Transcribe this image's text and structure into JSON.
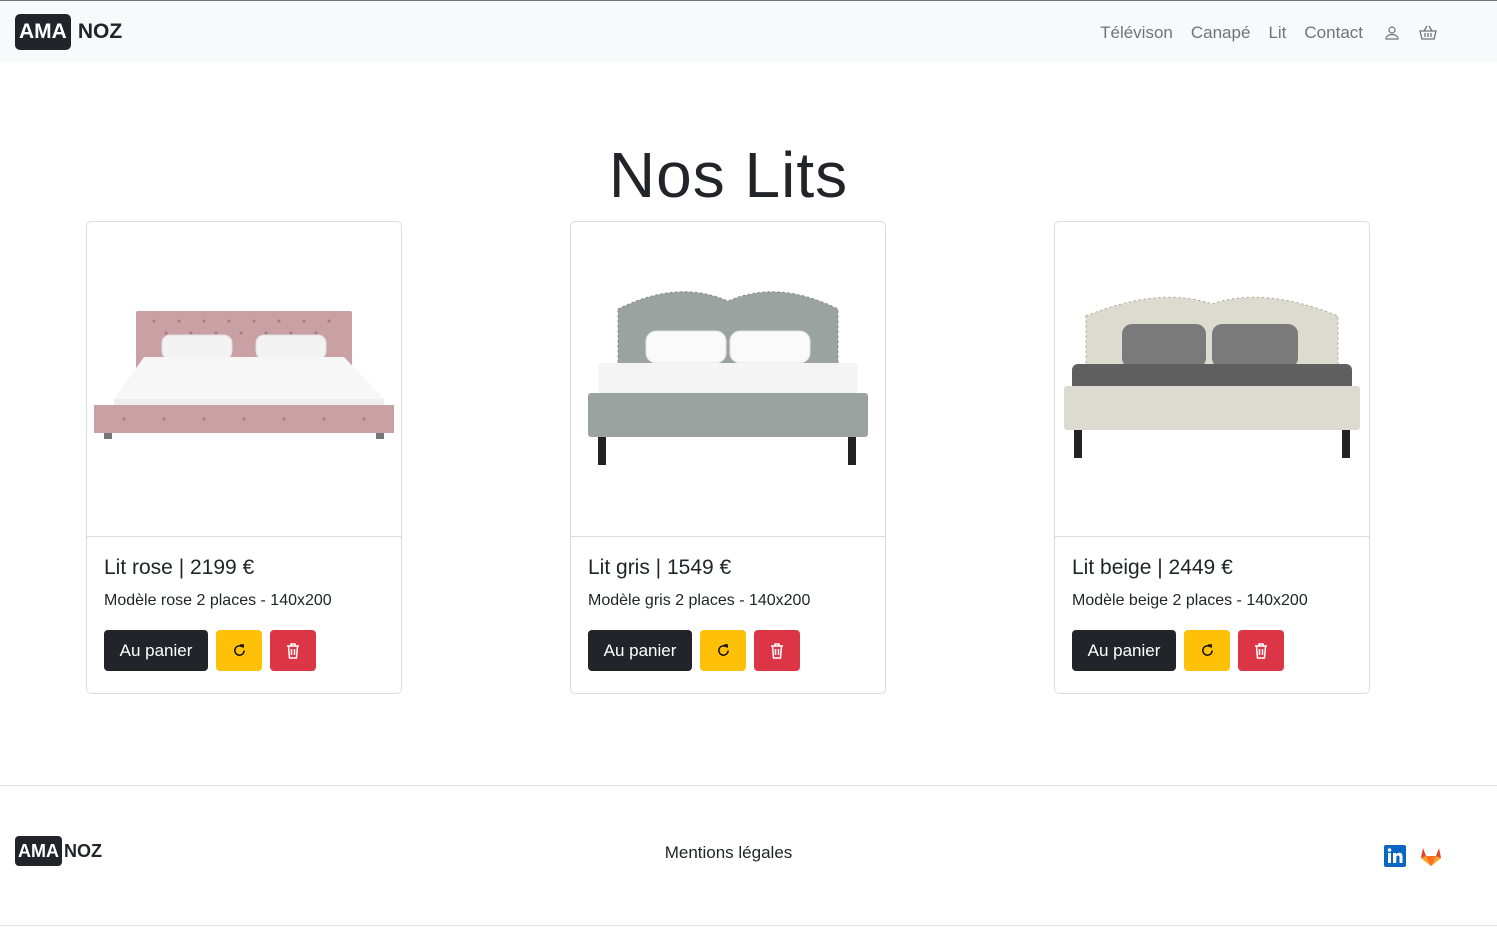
{
  "brand": {
    "box": "AMA",
    "rest": "NOZ"
  },
  "nav": {
    "links": [
      "Télévison",
      "Canapé",
      "Lit",
      "Contact"
    ],
    "icons": [
      "user-icon",
      "basket-icon"
    ]
  },
  "main": {
    "title": "Nos Lits"
  },
  "products": [
    {
      "title": "Lit rose | 2199 €",
      "description": "Modèle rose 2 places - 140x200",
      "cart_label": "Au panier",
      "color": "#c9a0a4"
    },
    {
      "title": "Lit gris | 1549 €",
      "description": "Modèle gris 2 places - 140x200",
      "cart_label": "Au panier",
      "color": "#9ba3a0"
    },
    {
      "title": "Lit beige | 2449 €",
      "description": "Modèle beige 2 places - 140x200",
      "cart_label": "Au panier",
      "color": "#dddbcf"
    }
  ],
  "footer": {
    "brand_box": "AMA",
    "brand_rest": "NOZ",
    "legal_link": "Mentions légales",
    "icons": [
      "linkedin-icon",
      "gitlab-icon"
    ]
  },
  "colors": {
    "dark": "#212529",
    "warning": "#ffc107",
    "danger": "#dc3545",
    "navbar": "#f8f9fa"
  }
}
